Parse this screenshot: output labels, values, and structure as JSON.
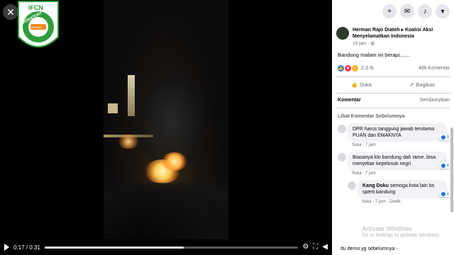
{
  "player": {
    "current_time": "0:17",
    "separator": "/",
    "duration": "0:31",
    "progress_fraction": 0.548,
    "close_glyph": "✕"
  },
  "seal": {
    "top_text": "CN",
    "ring_text": "SIGNATORY",
    "badge_text": "turn backhoax",
    "bottom_text": "VERIFIED · INTERNATIONAL FACT-CHECKING NETWORK",
    "brand_color": "#2e9e3a"
  },
  "post": {
    "author": "Herman Rajo Diateh",
    "arrow": "▸",
    "group": "Koalisi Aksi Menyelamatkan Indonesia",
    "time": "19 jam",
    "privacy_icon": "globe-icon",
    "text": "Bandung malam ini berapi.......",
    "reaction_count": "2,3 rb",
    "comment_count": "486 Komentar"
  },
  "actions": {
    "like_label": "Suka",
    "share_label": "Bagikan"
  },
  "comments_section": {
    "title": "Komentar",
    "sort_label": "Sembunyikan",
    "see_previous": "Lihat Komentar Sebelumnya",
    "items": [
      {
        "name": "",
        "text": "DPR harus tanggung jawab terutama PUAN dan EMAKNYA",
        "like": "Suka",
        "time": "7 jam",
        "reactions": "3"
      },
      {
        "name": "",
        "text": "Biasanya klo bandung dah rame..bisa menyebar kepelosok negri",
        "like": "Suka",
        "time": "7 jam",
        "reactions": "4"
      },
      {
        "name": "Kang Doku",
        "text": "semoga kota lain bs sperti bandung",
        "like": "Suka",
        "time": "7 jam",
        "reply": "Diedit",
        "reactions": "1"
      }
    ],
    "last_comment_preview": "Itu demo yg sebelumnya -"
  },
  "os_watermark": {
    "line1": "Activate Windows",
    "line2": "Go to Settings to activate Windows."
  },
  "colors": {
    "facebook_blue": "#1877f2",
    "panel_bg": "#ffffff",
    "video_bg": "#000000"
  }
}
